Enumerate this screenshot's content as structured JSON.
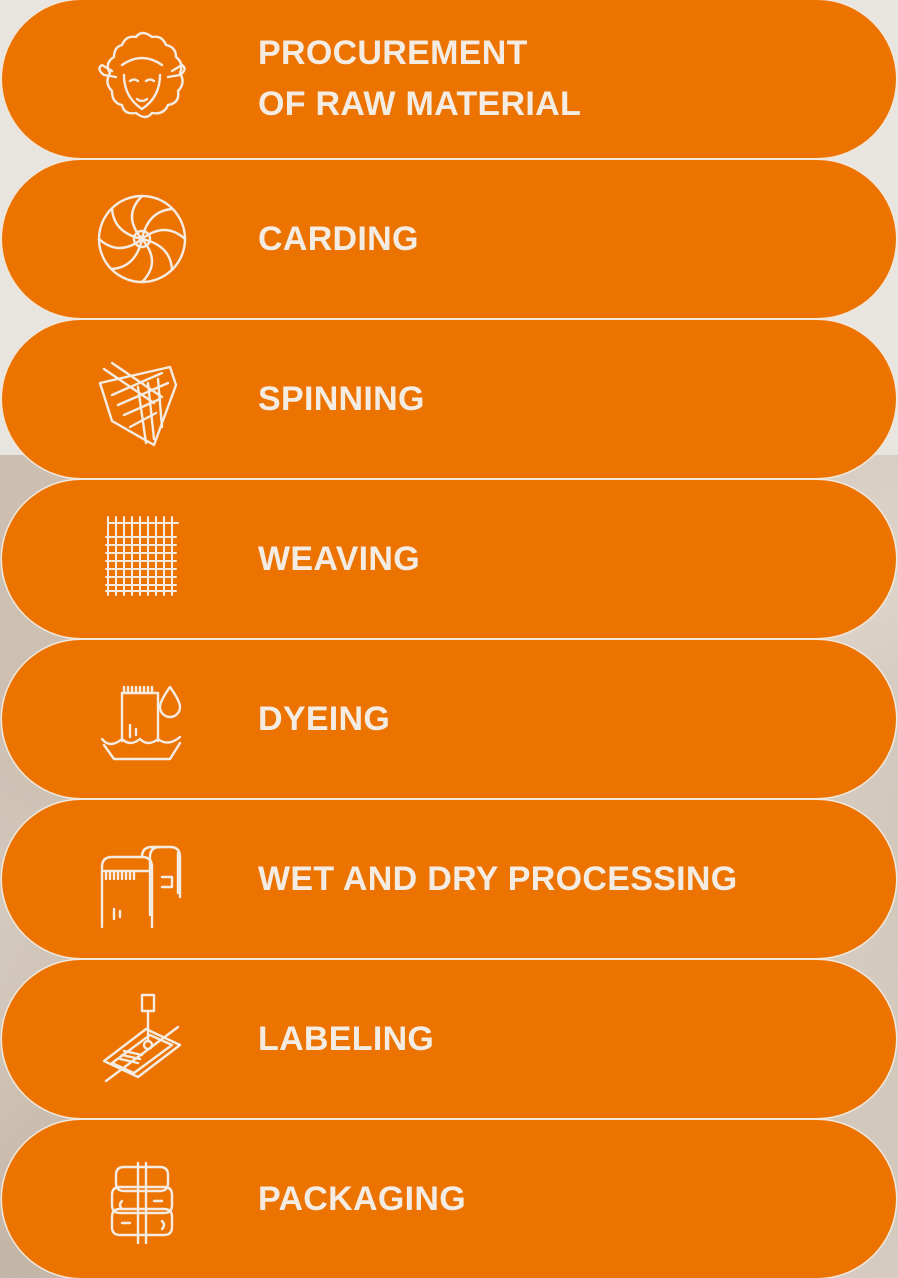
{
  "steps": [
    {
      "label": "PROCUREMENT\nOF RAW MATERIAL",
      "icon": "sheep-icon"
    },
    {
      "label": "CARDING",
      "icon": "wool-ball-icon"
    },
    {
      "label": "SPINNING",
      "icon": "yarn-spool-icon"
    },
    {
      "label": "WEAVING",
      "icon": "woven-fabric-icon"
    },
    {
      "label": "DYEING",
      "icon": "dye-bath-icon"
    },
    {
      "label": "WET AND DRY PROCESSING",
      "icon": "fabric-rollers-icon"
    },
    {
      "label": "LABELING",
      "icon": "label-stamp-icon"
    },
    {
      "label": "PACKAGING",
      "icon": "fabric-stack-icon"
    }
  ],
  "colors": {
    "pill": "#ec7300",
    "text": "#f4ece3",
    "background_top": "#e8e4df"
  }
}
